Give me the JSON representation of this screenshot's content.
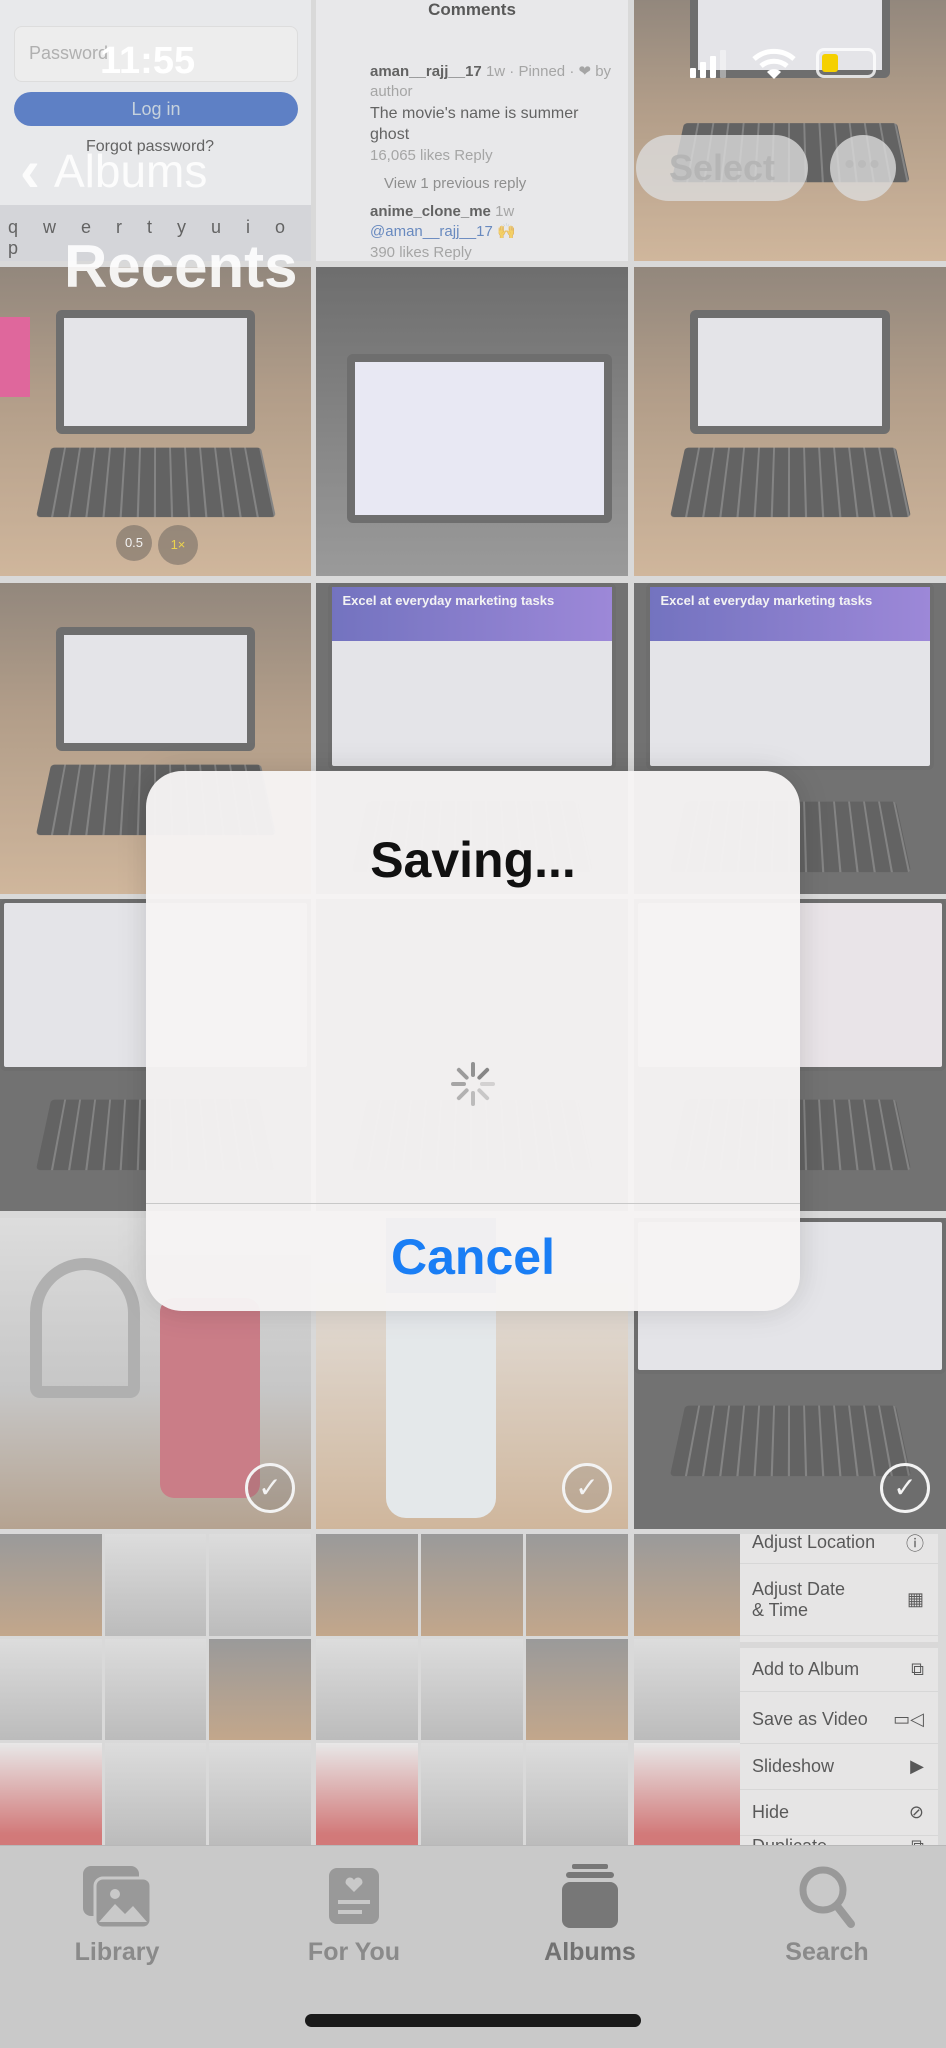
{
  "status_bar": {
    "time": "11:55",
    "battery_color": "#f5d000"
  },
  "nav": {
    "back_label": "Albums",
    "title": "Recents",
    "select_label": "Select",
    "more_label": "•••"
  },
  "photos": {
    "login": {
      "password_placeholder": "Password",
      "login_button": "Log in",
      "forgot": "Forgot password?",
      "keys": "q w e r t y u i o p"
    },
    "comments": {
      "header": "Comments",
      "user1": "aman__rajj__17",
      "meta1": "1w · Pinned · ❤ by author",
      "text1": "The movie's name is summer ghost",
      "likes1": "16,065 likes   Reply",
      "view_replies": "View 1 previous reply",
      "user2": "anime_clone_me",
      "meta2": "1w",
      "text2": "@aman__rajj__17 🙌",
      "likes2": "390 likes   Reply"
    },
    "ad_text": "Excel at everyday marketing tasks",
    "zoom_levels": [
      "0.5",
      "1×"
    ]
  },
  "dialog": {
    "title": "Saving...",
    "cancel_label": "Cancel",
    "accent": "#1a7ef5"
  },
  "context_menu": {
    "items": [
      {
        "label": "Adjust Location",
        "icon": "info-circle-icon"
      },
      {
        "label": "Adjust Date & Time",
        "icon": "calendar-clock-icon"
      },
      {
        "label": "Add to Album",
        "icon": "add-album-icon"
      },
      {
        "label": "Save as Video",
        "icon": "video-icon"
      },
      {
        "label": "Slideshow",
        "icon": "play-icon"
      },
      {
        "label": "Hide",
        "icon": "eye-slash-icon"
      },
      {
        "label": "Duplicate",
        "icon": "duplicate-icon"
      }
    ]
  },
  "tabs": [
    {
      "label": "Library",
      "icon": "photo-library-icon"
    },
    {
      "label": "For You",
      "icon": "for-you-icon"
    },
    {
      "label": "Albums",
      "icon": "albums-icon",
      "active": true
    },
    {
      "label": "Search",
      "icon": "search-icon"
    }
  ]
}
